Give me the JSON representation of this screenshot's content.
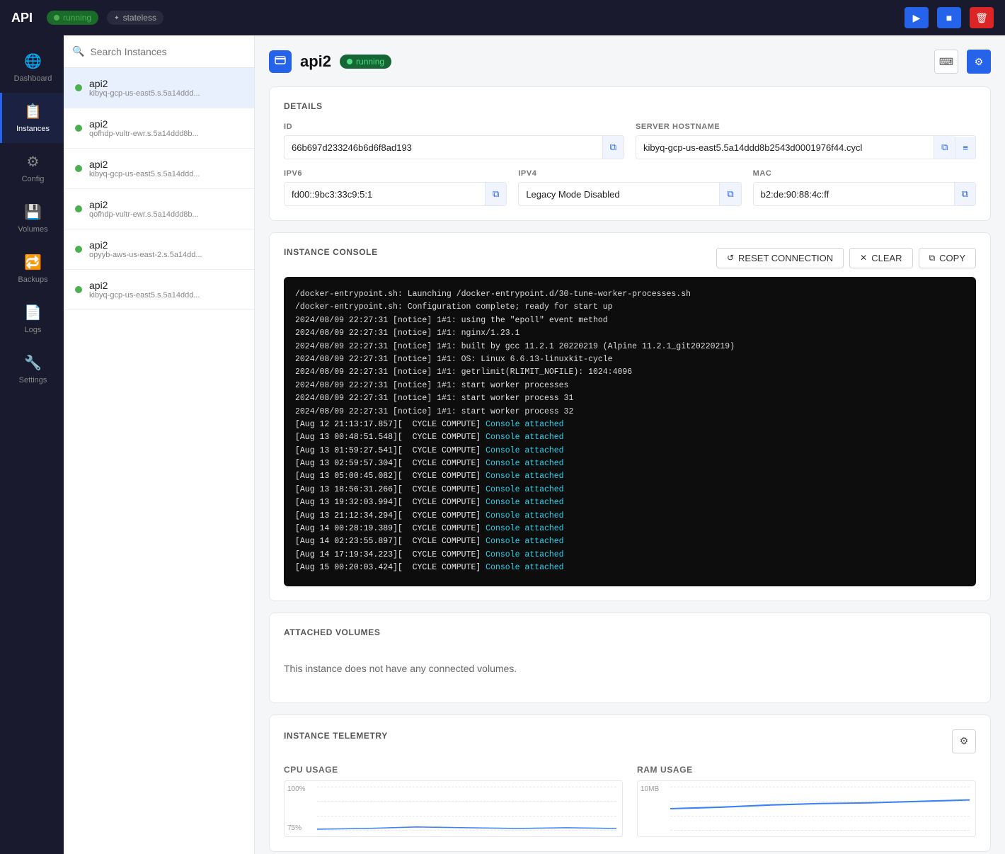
{
  "topbar": {
    "title": "API",
    "badge_running": "running",
    "badge_stateless": "stateless",
    "btn_play": "▶",
    "btn_stop": "■",
    "btn_delete": "🗑"
  },
  "sidebar": {
    "items": [
      {
        "id": "dashboard",
        "label": "Dashboard",
        "icon": "🌐",
        "active": false
      },
      {
        "id": "instances",
        "label": "Instances",
        "icon": "📋",
        "active": true
      },
      {
        "id": "config",
        "label": "Config",
        "icon": "⚙",
        "active": false
      },
      {
        "id": "volumes",
        "label": "Volumes",
        "icon": "💾",
        "active": false
      },
      {
        "id": "backups",
        "label": "Backups",
        "icon": "🔁",
        "active": false
      },
      {
        "id": "logs",
        "label": "Logs",
        "icon": "📄",
        "active": false
      },
      {
        "id": "settings",
        "label": "Settings",
        "icon": "🔧",
        "active": false
      }
    ]
  },
  "instance_list": {
    "search_placeholder": "Search Instances",
    "instances": [
      {
        "name": "api2",
        "sub": "kibyq-gcp-us-east5.s.5a14ddd...",
        "active": true
      },
      {
        "name": "api2",
        "sub": "qofhdp-vultr-ewr.s.5a14ddd8b...",
        "active": false
      },
      {
        "name": "api2",
        "sub": "kibyq-gcp-us-east5.s.5a14ddd...",
        "active": false
      },
      {
        "name": "api2",
        "sub": "qofhdp-vultr-ewr.s.5a14ddd8b...",
        "active": false
      },
      {
        "name": "api2",
        "sub": "opyyb-aws-us-east-2.s.5a14dd...",
        "active": false
      },
      {
        "name": "api2",
        "sub": "kibyq-gcp-us-east5.s.5a14ddd...",
        "active": false
      }
    ]
  },
  "detail": {
    "instance_name": "api2",
    "status": "running",
    "section_details": "DETAILS",
    "fields": {
      "id_label": "ID",
      "id_value": "66b697d233246b6d6f8ad193",
      "server_hostname_label": "SERVER HOSTNAME",
      "server_hostname_value": "kibyq-gcp-us-east5.5a14ddd8b2543d0001976f44.cycl",
      "ipv6_label": "IPV6",
      "ipv6_value": "fd00::9bc3:33c9:5:1",
      "ipv4_label": "IPV4",
      "ipv4_value": "Legacy Mode Disabled",
      "mac_label": "MAC",
      "mac_value": "b2:de:90:88:4c:ff"
    },
    "section_console": "INSTANCE CONSOLE",
    "btn_reset": "RESET CONNECTION",
    "btn_clear": "CLEAR",
    "btn_copy": "COPY",
    "console_lines": [
      "/docker-entrypoint.sh: Launching /docker-entrypoint.d/30-tune-worker-processes.sh",
      "/docker-entrypoint.sh: Configuration complete; ready for start up",
      "2024/08/09 22:27:31 [notice] 1#1: using the \"epoll\" event method",
      "2024/08/09 22:27:31 [notice] 1#1: nginx/1.23.1",
      "2024/08/09 22:27:31 [notice] 1#1: built by gcc 11.2.1 20220219 (Alpine 11.2.1_git20220219)",
      "2024/08/09 22:27:31 [notice] 1#1: OS: Linux 6.6.13-linuxkit-cycle",
      "2024/08/09 22:27:31 [notice] 1#1: getrlimit(RLIMIT_NOFILE): 1024:4096",
      "2024/08/09 22:27:31 [notice] 1#1: start worker processes",
      "2024/08/09 22:27:31 [notice] 1#1: start worker process 31",
      "2024/08/09 22:27:31 [notice] 1#1: start worker process 32",
      "[Aug 12 21:13:17.857][  CYCLE COMPUTE]",
      "[Aug 13 00:48:51.548][  CYCLE COMPUTE]",
      "[Aug 13 01:59:27.541][  CYCLE COMPUTE]",
      "[Aug 13 02:59:57.304][  CYCLE COMPUTE]",
      "[Aug 13 05:00:45.082][  CYCLE COMPUTE]",
      "[Aug 13 18:56:31.266][  CYCLE COMPUTE]",
      "[Aug 13 19:32:03.994][  CYCLE COMPUTE]",
      "[Aug 13 21:12:34.294][  CYCLE COMPUTE]",
      "[Aug 14 00:28:19.389][  CYCLE COMPUTE]",
      "[Aug 14 02:23:55.897][  CYCLE COMPUTE]",
      "[Aug 14 17:19:34.223][  CYCLE COMPUTE]",
      "[Aug 15 00:20:03.424][  CYCLE COMPUTE]"
    ],
    "console_attached_label": "Console attached",
    "section_volumes": "ATTACHED VOLUMES",
    "no_volumes_msg": "This instance does not have any connected volumes.",
    "section_telemetry": "INSTANCE TELEMETRY",
    "cpu_label": "CPU USAGE",
    "ram_label": "RAM USAGE",
    "cpu_y_top": "100%",
    "cpu_y_mid": "75%",
    "ram_y_top": "10MB"
  }
}
